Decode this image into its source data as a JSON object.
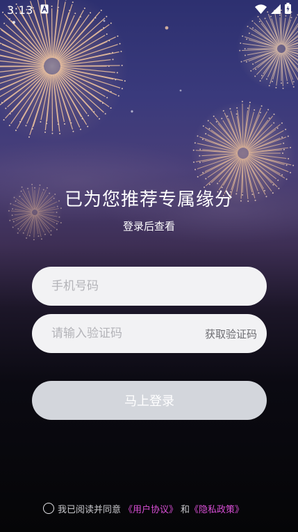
{
  "status_bar": {
    "time": "3:13",
    "icons": [
      "notification-a-icon",
      "wifi-icon",
      "cellular-signal-icon",
      "battery-charging-icon"
    ]
  },
  "hero": {
    "title": "已为您推荐专属缘分",
    "subtitle": "登录后查看"
  },
  "form": {
    "phone_placeholder": "手机号码",
    "code_placeholder": "请输入验证码",
    "get_code_label": "获取验证码",
    "login_label": "马上登录"
  },
  "agreement": {
    "prefix": "我已阅读并同意",
    "user_agreement": "《用户协议》",
    "conjunction": "和",
    "privacy_policy": "《隐私政策》"
  },
  "colors": {
    "link": "#d94fd6",
    "login_button": "#d3d6dc",
    "input_background": "#f2f2f4"
  }
}
